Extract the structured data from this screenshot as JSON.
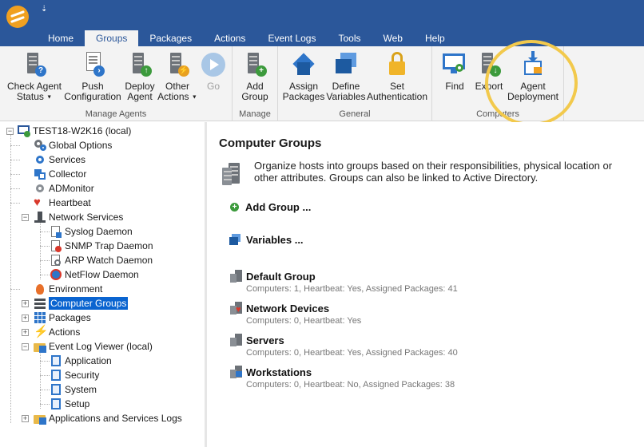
{
  "app": {
    "qat_symbol": "⇣"
  },
  "tabs": [
    "Home",
    "Groups",
    "Packages",
    "Actions",
    "Event Logs",
    "Tools",
    "Web",
    "Help"
  ],
  "active_tab": "Groups",
  "ribbon": {
    "manage_agents": {
      "label": "Manage Agents",
      "check_status": [
        "Check Agent",
        "Status"
      ],
      "push_config": [
        "Push",
        "Configuration"
      ],
      "deploy_agent": [
        "Deploy",
        "Agent"
      ],
      "other_actions": [
        "Other",
        "Actions"
      ],
      "go": "Go"
    },
    "manage": {
      "label": "Manage",
      "add_group": [
        "Add",
        "Group"
      ]
    },
    "general": {
      "label": "General",
      "assign_packages": [
        "Assign",
        "Packages"
      ],
      "define_variables": [
        "Define",
        "Variables"
      ],
      "set_auth": [
        "Set",
        "Authentication"
      ]
    },
    "computers": {
      "label": "Computers",
      "find": "Find",
      "export": "Export",
      "agent_deployment": [
        "Agent",
        "Deployment"
      ]
    }
  },
  "tree": {
    "root": "TEST18-W2K16 (local)",
    "global_options": "Global Options",
    "services": "Services",
    "collector": "Collector",
    "admonitor": "ADMonitor",
    "heartbeat": "Heartbeat",
    "network_services": "Network Services",
    "syslog": "Syslog Daemon",
    "snmp": "SNMP Trap Daemon",
    "arp": "ARP Watch Daemon",
    "netflow": "NetFlow Daemon",
    "environment": "Environment",
    "computer_groups": "Computer Groups",
    "packages": "Packages",
    "actions": "Actions",
    "event_log_viewer": "Event Log Viewer (local)",
    "application": "Application",
    "security": "Security",
    "system": "System",
    "setup": "Setup",
    "apps_services_logs": "Applications and Services Logs"
  },
  "main": {
    "title": "Computer Groups",
    "description": "Organize hosts into groups based on their responsibilities, physical location or other attributes. Groups can also be linked to Active Directory.",
    "add_group": "Add Group ...",
    "variables": "Variables ...",
    "groups": [
      {
        "name": "Default Group",
        "info": "Computers: 1, Heartbeat: Yes, Assigned Packages: 41"
      },
      {
        "name": "Network Devices",
        "info": "Computers: 0, Heartbeat: Yes"
      },
      {
        "name": "Servers",
        "info": "Computers: 0, Heartbeat: Yes, Assigned Packages: 40"
      },
      {
        "name": "Workstations",
        "info": "Computers: 0, Heartbeat: No, Assigned Packages: 38"
      }
    ]
  },
  "colors": {
    "title_bar": "#2b579a",
    "selection": "#0a64d0",
    "highlight": "#f2c94c"
  }
}
